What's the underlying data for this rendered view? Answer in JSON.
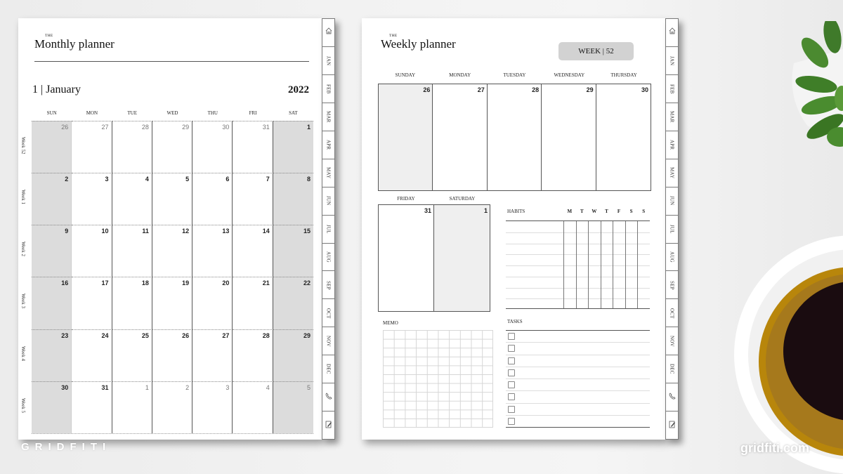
{
  "monthly": {
    "title_prefix": "THE",
    "title": "Monthly planner",
    "month_label": "1 | January",
    "year": "2022",
    "days_of_week": [
      "SUN",
      "MON",
      "TUE",
      "WED",
      "THU",
      "FRI",
      "SAT"
    ],
    "weeks": [
      {
        "label": "Week 52",
        "days": [
          {
            "n": "26",
            "other": true
          },
          {
            "n": "27",
            "other": true
          },
          {
            "n": "28",
            "other": true
          },
          {
            "n": "29",
            "other": true
          },
          {
            "n": "30",
            "other": true
          },
          {
            "n": "31",
            "other": true
          },
          {
            "n": "1",
            "other": false
          }
        ]
      },
      {
        "label": "Week 1",
        "days": [
          {
            "n": "2"
          },
          {
            "n": "3"
          },
          {
            "n": "4"
          },
          {
            "n": "5"
          },
          {
            "n": "6"
          },
          {
            "n": "7"
          },
          {
            "n": "8"
          }
        ]
      },
      {
        "label": "Week 2",
        "days": [
          {
            "n": "9"
          },
          {
            "n": "10"
          },
          {
            "n": "11"
          },
          {
            "n": "12"
          },
          {
            "n": "13"
          },
          {
            "n": "14"
          },
          {
            "n": "15"
          }
        ]
      },
      {
        "label": "Week 3",
        "days": [
          {
            "n": "16"
          },
          {
            "n": "17"
          },
          {
            "n": "18"
          },
          {
            "n": "19"
          },
          {
            "n": "20"
          },
          {
            "n": "21"
          },
          {
            "n": "22"
          }
        ]
      },
      {
        "label": "Week 4",
        "days": [
          {
            "n": "23"
          },
          {
            "n": "24"
          },
          {
            "n": "25"
          },
          {
            "n": "26"
          },
          {
            "n": "27"
          },
          {
            "n": "28"
          },
          {
            "n": "29"
          }
        ]
      },
      {
        "label": "Week 5",
        "days": [
          {
            "n": "30"
          },
          {
            "n": "31"
          },
          {
            "n": "1",
            "other": true
          },
          {
            "n": "2",
            "other": true
          },
          {
            "n": "3",
            "other": true
          },
          {
            "n": "4",
            "other": true
          },
          {
            "n": "5",
            "other": true
          }
        ]
      }
    ]
  },
  "weekly": {
    "title_prefix": "THE",
    "title": "Weekly planner",
    "week_badge": "WEEK | 52",
    "row1": [
      {
        "day": "SUNDAY",
        "n": "26",
        "shade": true
      },
      {
        "day": "MONDAY",
        "n": "27"
      },
      {
        "day": "TUESDAY",
        "n": "28"
      },
      {
        "day": "WEDNESDAY",
        "n": "29"
      },
      {
        "day": "THURSDAY",
        "n": "30"
      }
    ],
    "row2": [
      {
        "day": "FRIDAY",
        "n": "31"
      },
      {
        "day": "SATURDAY",
        "n": "1",
        "shade": true
      }
    ],
    "habits": {
      "label": "HABITS",
      "days": [
        "M",
        "T",
        "W",
        "T",
        "F",
        "S",
        "S"
      ],
      "rows": 8
    },
    "memo_label": "MEMO",
    "tasks": {
      "label": "TASKS",
      "count": 8
    }
  },
  "tabs": [
    {
      "type": "icon",
      "icon": "home-icon"
    },
    {
      "type": "text",
      "label": "JAN"
    },
    {
      "type": "text",
      "label": "FEB"
    },
    {
      "type": "text",
      "label": "MAR"
    },
    {
      "type": "text",
      "label": "APR"
    },
    {
      "type": "text",
      "label": "MAY"
    },
    {
      "type": "text",
      "label": "JUN"
    },
    {
      "type": "text",
      "label": "JUL"
    },
    {
      "type": "text",
      "label": "AUG"
    },
    {
      "type": "text",
      "label": "SEP"
    },
    {
      "type": "text",
      "label": "OCT"
    },
    {
      "type": "text",
      "label": "NOV"
    },
    {
      "type": "text",
      "label": "DEC"
    },
    {
      "type": "icon",
      "icon": "phone-icon"
    },
    {
      "type": "icon",
      "icon": "notes-icon"
    }
  ],
  "branding": {
    "left": "GRIDFITI",
    "right": "gridfiti.com"
  },
  "colors": {
    "weekend_shade": "#dcdcdc",
    "badge": "#d2d2d2",
    "grid_line": "#555555"
  }
}
